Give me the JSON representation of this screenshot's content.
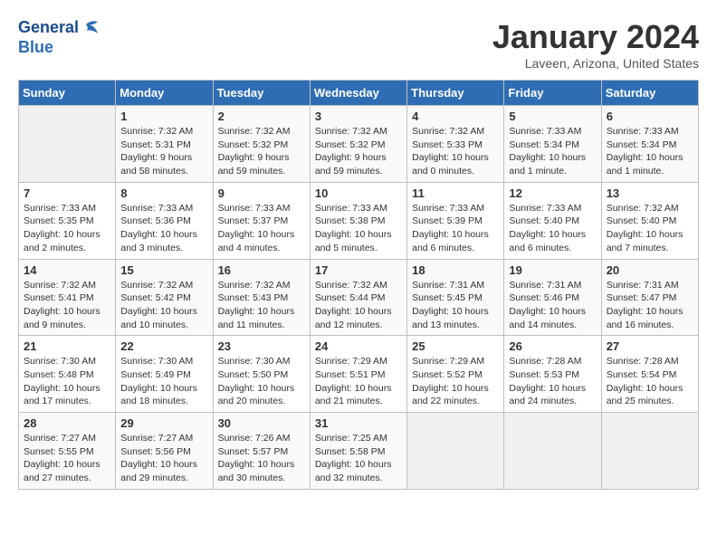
{
  "header": {
    "logo_line1": "General",
    "logo_line2": "Blue",
    "title": "January 2024",
    "subtitle": "Laveen, Arizona, United States"
  },
  "days_of_week": [
    "Sunday",
    "Monday",
    "Tuesday",
    "Wednesday",
    "Thursday",
    "Friday",
    "Saturday"
  ],
  "weeks": [
    [
      {
        "day": "",
        "info": ""
      },
      {
        "day": "1",
        "info": "Sunrise: 7:32 AM\nSunset: 5:31 PM\nDaylight: 9 hours\nand 58 minutes."
      },
      {
        "day": "2",
        "info": "Sunrise: 7:32 AM\nSunset: 5:32 PM\nDaylight: 9 hours\nand 59 minutes."
      },
      {
        "day": "3",
        "info": "Sunrise: 7:32 AM\nSunset: 5:32 PM\nDaylight: 9 hours\nand 59 minutes."
      },
      {
        "day": "4",
        "info": "Sunrise: 7:32 AM\nSunset: 5:33 PM\nDaylight: 10 hours\nand 0 minutes."
      },
      {
        "day": "5",
        "info": "Sunrise: 7:33 AM\nSunset: 5:34 PM\nDaylight: 10 hours\nand 1 minute."
      },
      {
        "day": "6",
        "info": "Sunrise: 7:33 AM\nSunset: 5:34 PM\nDaylight: 10 hours\nand 1 minute."
      }
    ],
    [
      {
        "day": "7",
        "info": "Sunrise: 7:33 AM\nSunset: 5:35 PM\nDaylight: 10 hours\nand 2 minutes."
      },
      {
        "day": "8",
        "info": "Sunrise: 7:33 AM\nSunset: 5:36 PM\nDaylight: 10 hours\nand 3 minutes."
      },
      {
        "day": "9",
        "info": "Sunrise: 7:33 AM\nSunset: 5:37 PM\nDaylight: 10 hours\nand 4 minutes."
      },
      {
        "day": "10",
        "info": "Sunrise: 7:33 AM\nSunset: 5:38 PM\nDaylight: 10 hours\nand 5 minutes."
      },
      {
        "day": "11",
        "info": "Sunrise: 7:33 AM\nSunset: 5:39 PM\nDaylight: 10 hours\nand 6 minutes."
      },
      {
        "day": "12",
        "info": "Sunrise: 7:33 AM\nSunset: 5:40 PM\nDaylight: 10 hours\nand 6 minutes."
      },
      {
        "day": "13",
        "info": "Sunrise: 7:32 AM\nSunset: 5:40 PM\nDaylight: 10 hours\nand 7 minutes."
      }
    ],
    [
      {
        "day": "14",
        "info": "Sunrise: 7:32 AM\nSunset: 5:41 PM\nDaylight: 10 hours\nand 9 minutes."
      },
      {
        "day": "15",
        "info": "Sunrise: 7:32 AM\nSunset: 5:42 PM\nDaylight: 10 hours\nand 10 minutes."
      },
      {
        "day": "16",
        "info": "Sunrise: 7:32 AM\nSunset: 5:43 PM\nDaylight: 10 hours\nand 11 minutes."
      },
      {
        "day": "17",
        "info": "Sunrise: 7:32 AM\nSunset: 5:44 PM\nDaylight: 10 hours\nand 12 minutes."
      },
      {
        "day": "18",
        "info": "Sunrise: 7:31 AM\nSunset: 5:45 PM\nDaylight: 10 hours\nand 13 minutes."
      },
      {
        "day": "19",
        "info": "Sunrise: 7:31 AM\nSunset: 5:46 PM\nDaylight: 10 hours\nand 14 minutes."
      },
      {
        "day": "20",
        "info": "Sunrise: 7:31 AM\nSunset: 5:47 PM\nDaylight: 10 hours\nand 16 minutes."
      }
    ],
    [
      {
        "day": "21",
        "info": "Sunrise: 7:30 AM\nSunset: 5:48 PM\nDaylight: 10 hours\nand 17 minutes."
      },
      {
        "day": "22",
        "info": "Sunrise: 7:30 AM\nSunset: 5:49 PM\nDaylight: 10 hours\nand 18 minutes."
      },
      {
        "day": "23",
        "info": "Sunrise: 7:30 AM\nSunset: 5:50 PM\nDaylight: 10 hours\nand 20 minutes."
      },
      {
        "day": "24",
        "info": "Sunrise: 7:29 AM\nSunset: 5:51 PM\nDaylight: 10 hours\nand 21 minutes."
      },
      {
        "day": "25",
        "info": "Sunrise: 7:29 AM\nSunset: 5:52 PM\nDaylight: 10 hours\nand 22 minutes."
      },
      {
        "day": "26",
        "info": "Sunrise: 7:28 AM\nSunset: 5:53 PM\nDaylight: 10 hours\nand 24 minutes."
      },
      {
        "day": "27",
        "info": "Sunrise: 7:28 AM\nSunset: 5:54 PM\nDaylight: 10 hours\nand 25 minutes."
      }
    ],
    [
      {
        "day": "28",
        "info": "Sunrise: 7:27 AM\nSunset: 5:55 PM\nDaylight: 10 hours\nand 27 minutes."
      },
      {
        "day": "29",
        "info": "Sunrise: 7:27 AM\nSunset: 5:56 PM\nDaylight: 10 hours\nand 29 minutes."
      },
      {
        "day": "30",
        "info": "Sunrise: 7:26 AM\nSunset: 5:57 PM\nDaylight: 10 hours\nand 30 minutes."
      },
      {
        "day": "31",
        "info": "Sunrise: 7:25 AM\nSunset: 5:58 PM\nDaylight: 10 hours\nand 32 minutes."
      },
      {
        "day": "",
        "info": ""
      },
      {
        "day": "",
        "info": ""
      },
      {
        "day": "",
        "info": ""
      }
    ]
  ]
}
